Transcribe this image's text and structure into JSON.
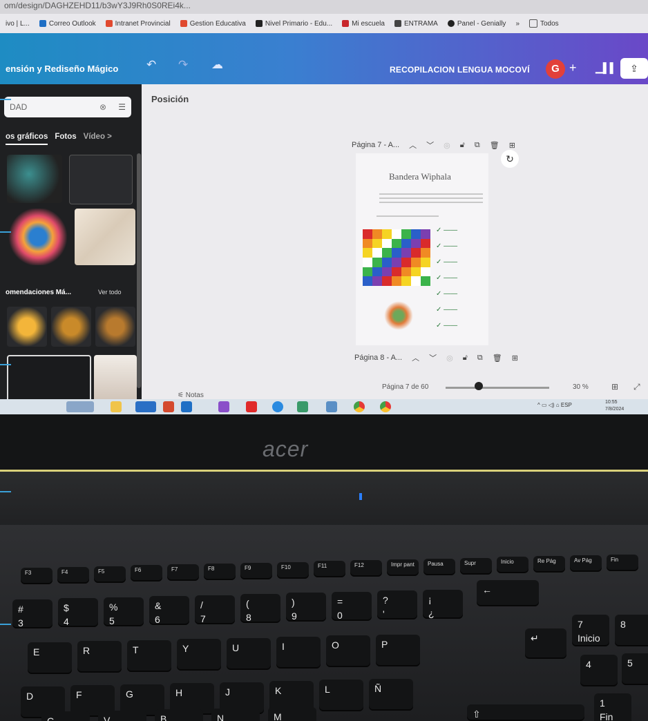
{
  "browser": {
    "url": "om/design/DAGHZEHD11/b3wY3J9Rh0S0REi4k...",
    "bookmarks": [
      "ivo | L...",
      "Correo Outlook",
      "Intranet Provincial",
      "Gestion Educativa",
      "Nivel Primario - Edu...",
      "Mi escuela",
      "ENTRAMA",
      "Panel - Genially",
      "»",
      "Todos"
    ]
  },
  "editor": {
    "project_title": "ensión y Rediseño Mágico",
    "doc_title": "RECOPILACION LENGUA MOCOVÍ",
    "avatar_letter": "G",
    "plus": "+",
    "undo_icon": "undo-icon",
    "redo_icon": "redo-icon",
    "cloud_icon": "cloud-icon"
  },
  "sidebar": {
    "search_value": "DAD",
    "tabs": [
      "os gráficos",
      "Fotos",
      "Vídeo >"
    ],
    "rec_title": "omendaciones Má...",
    "see_all": "Ver todo"
  },
  "canvas": {
    "section": "Posición",
    "page7_label": "Página 7 - A...",
    "page8_label": "Página 8 - A...",
    "page_title": "Bandera Wiphala",
    "footer_notes": "Notas",
    "page_indicator": "Página 7 de 60",
    "zoom": "30 %",
    "zoom_fraction": 0.32
  },
  "tray": {
    "lang": "ESP",
    "time": "10:55",
    "date": "7/8/2024"
  },
  "laptop": {
    "brand": "acer"
  },
  "keyboard": {
    "fn_row": [
      "F3",
      "F4",
      "F5",
      "F6",
      "F7",
      "F8",
      "F9",
      "F10",
      "F11",
      "F12",
      "Impr pant",
      "Pausa",
      "Supr",
      "Inicio",
      "Re Pág",
      "Av Pág",
      "Fin"
    ],
    "num_row": [
      "#",
      "$",
      "%",
      "&",
      "/",
      "(",
      ")",
      "=",
      "?",
      "¡"
    ],
    "num_row_sub": [
      "3",
      "4",
      "5",
      "6",
      "7",
      "8",
      "9",
      "0",
      "'",
      "¿"
    ],
    "row_q": [
      "E",
      "R",
      "T",
      "Y",
      "U",
      "I",
      "O",
      "P"
    ],
    "row_a": [
      "D",
      "F",
      "G",
      "H",
      "J",
      "K",
      "L",
      "Ñ"
    ],
    "row_z": [
      "C",
      "V",
      "B",
      "N",
      "M"
    ],
    "numpad": [
      "7",
      "8",
      "4",
      "5",
      "1"
    ],
    "numpad_sub": [
      "Inicio",
      "",
      "",
      "",
      "Fin"
    ]
  }
}
